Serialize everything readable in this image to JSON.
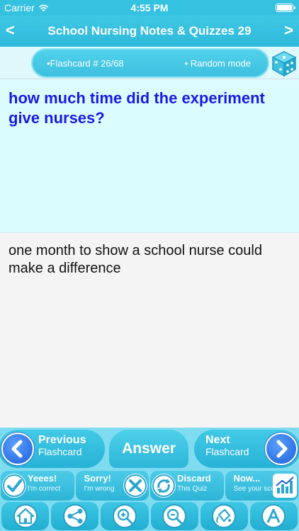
{
  "status_bar": {
    "carrier": "Carrier",
    "time": "4:55 PM"
  },
  "nav": {
    "title": "School Nursing Notes & Quizzes 29",
    "back_glyph": "<",
    "forward_glyph": ">"
  },
  "info": {
    "flashcard_label": "•Flashcard #  26/68",
    "mode_label": "• Random mode"
  },
  "question": {
    "text": "how much time did the experiment give nurses?"
  },
  "answer": {
    "text": "one month to show a school nurse could make a difference"
  },
  "nav_buttons": {
    "previous_title": "Previous",
    "previous_sub": "Flashcard",
    "answer_label": "Answer",
    "next_title": "Next",
    "next_sub": "Flashcard"
  },
  "actions": [
    {
      "title": "Yeees!",
      "sub": "I'm correct"
    },
    {
      "title": "Sorry!",
      "sub": "I'm wrong"
    },
    {
      "title": "Discard",
      "sub": "This Quiz"
    },
    {
      "title": "Now...",
      "sub": "See your score"
    }
  ],
  "toolbar": [
    "home-icon",
    "share-icon",
    "zoom-in-icon",
    "zoom-out-icon",
    "bucket-icon",
    "font-icon"
  ],
  "colors": {
    "accent": "#35c1e0",
    "question_text": "#1a1ae6",
    "question_bg": "#dcfdff",
    "button_blue": "#1d5fd8"
  }
}
